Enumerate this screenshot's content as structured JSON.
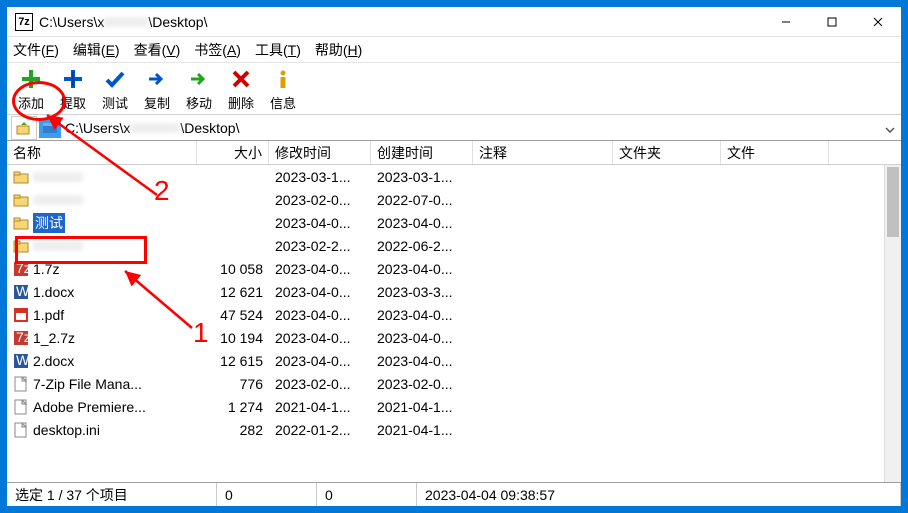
{
  "window": {
    "title_prefix": "C:\\Users\\x",
    "title_suffix": "\\Desktop\\",
    "app_icon_text": "7z"
  },
  "menu": {
    "file": "文件",
    "file_accel": "F",
    "edit": "编辑",
    "edit_accel": "E",
    "view": "查看",
    "view_accel": "V",
    "bookmark": "书签",
    "bookmark_accel": "A",
    "tool": "工具",
    "tool_accel": "T",
    "help": "帮助",
    "help_accel": "H"
  },
  "toolbar": {
    "add": "添加",
    "extract": "提取",
    "test": "测试",
    "copy": "复制",
    "move": "移动",
    "delete": "删除",
    "info": "信息"
  },
  "address": {
    "path_prefix": "C:\\Users\\x",
    "path_suffix": "\\Desktop\\"
  },
  "headers": {
    "name": "名称",
    "size": "大小",
    "modified": "修改时间",
    "created": "创建时间",
    "comment": "注释",
    "folder": "文件夹",
    "file": "文件"
  },
  "rows": [
    {
      "icon": "folder",
      "name": "",
      "blurred": true,
      "size": "",
      "mod": "2023-03-1...",
      "crt": "2023-03-1...",
      "selected": false
    },
    {
      "icon": "folder",
      "name": "",
      "blurred": true,
      "size": "",
      "mod": "2023-02-0...",
      "crt": "2022-07-0...",
      "selected": false
    },
    {
      "icon": "folder",
      "name": "测试",
      "size": "",
      "mod": "2023-04-0...",
      "crt": "2023-04-0...",
      "selected": true
    },
    {
      "icon": "folder",
      "name": "",
      "blurred": true,
      "size": "",
      "mod": "2023-02-2...",
      "crt": "2022-06-2...",
      "selected": false
    },
    {
      "icon": "7z",
      "name": "1.7z",
      "size": "10 058",
      "mod": "2023-04-0...",
      "crt": "2023-04-0...",
      "selected": false
    },
    {
      "icon": "docx",
      "name": "1.docx",
      "size": "12 621",
      "mod": "2023-04-0...",
      "crt": "2023-03-3...",
      "selected": false
    },
    {
      "icon": "pdf",
      "name": "1.pdf",
      "size": "47 524",
      "mod": "2023-04-0...",
      "crt": "2023-04-0...",
      "selected": false
    },
    {
      "icon": "7z",
      "name": "1_2.7z",
      "size": "10 194",
      "mod": "2023-04-0...",
      "crt": "2023-04-0...",
      "selected": false
    },
    {
      "icon": "docx",
      "name": "2.docx",
      "size": "12 615",
      "mod": "2023-04-0...",
      "crt": "2023-04-0...",
      "selected": false
    },
    {
      "icon": "file",
      "name": "7-Zip File Mana...",
      "size": "776",
      "mod": "2023-02-0...",
      "crt": "2023-02-0...",
      "selected": false
    },
    {
      "icon": "file",
      "name": "Adobe Premiere...",
      "size": "1 274",
      "mod": "2021-04-1...",
      "crt": "2021-04-1...",
      "selected": false
    },
    {
      "icon": "file",
      "name": "desktop.ini",
      "size": "282",
      "mod": "2022-01-2...",
      "crt": "2021-04-1...",
      "selected": false
    }
  ],
  "status": {
    "selection": "选定 1 / 37 个项目",
    "p2": "0",
    "p3": "0",
    "p4": "2023-04-04 09:38:57"
  },
  "annotations": {
    "one": "1",
    "two": "2"
  }
}
